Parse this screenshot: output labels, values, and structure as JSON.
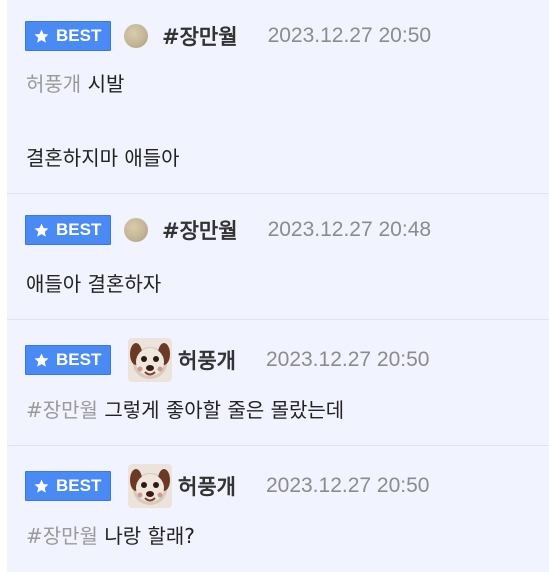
{
  "badge_label": "BEST",
  "colors": {
    "badge_bg": "#4a8af4",
    "card_bg": "#f1f3fe",
    "mention": "#9a9a9a",
    "timestamp": "#8c8c8c"
  },
  "comments": [
    {
      "author": "#장만월",
      "avatar": "beige-dot-avatar",
      "time": "2023.12.27 20:50",
      "mention": "허풍개",
      "lines": [
        "시발",
        "",
        "결혼하지마 애들아"
      ]
    },
    {
      "author": "#장만월",
      "avatar": "beige-dot-avatar",
      "time": "2023.12.27 20:48",
      "mention": "",
      "lines": [
        "애들아 결혼하자"
      ]
    },
    {
      "author": "허풍개",
      "avatar": "dog-face-avatar",
      "time": "2023.12.27 20:50",
      "mention": "#장만월",
      "lines": [
        "그렇게 좋아할 줄은 몰랐는데"
      ]
    },
    {
      "author": "허풍개",
      "avatar": "dog-face-avatar",
      "time": "2023.12.27 20:50",
      "mention": "#장만월",
      "lines": [
        "나랑 할래?"
      ]
    }
  ]
}
